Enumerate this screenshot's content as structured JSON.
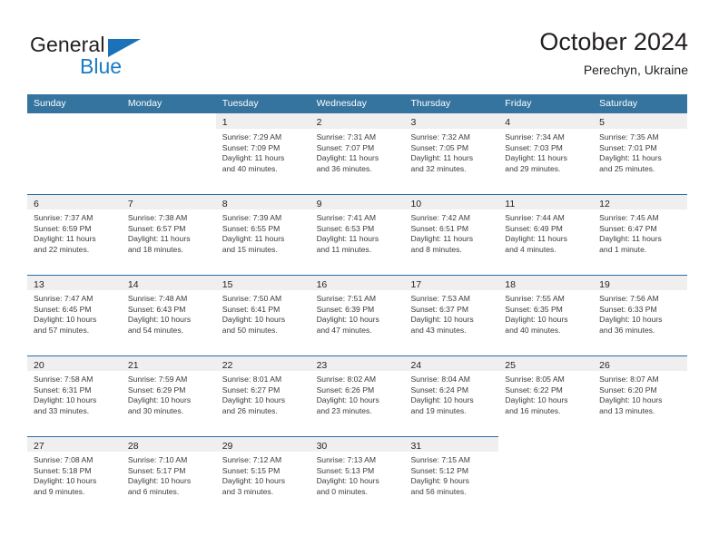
{
  "brand": {
    "name_part1": "General",
    "name_part2": "Blue",
    "accent_color": "#1b7ac4",
    "triangle_color": "#1b72b8"
  },
  "header": {
    "title": "October 2024",
    "subtitle": "Perechyn, Ukraine"
  },
  "theme": {
    "header_blue": "#35749f",
    "row_divider_blue": "#2a6ca5",
    "date_band_gray": "#efefef",
    "text_color": "#231f20"
  },
  "weekdays": [
    "Sunday",
    "Monday",
    "Tuesday",
    "Wednesday",
    "Thursday",
    "Friday",
    "Saturday"
  ],
  "weeks": [
    [
      {
        "date": "",
        "sunrise": "",
        "sunset": "",
        "daylight_l1": "",
        "daylight_l2": ""
      },
      {
        "date": "",
        "sunrise": "",
        "sunset": "",
        "daylight_l1": "",
        "daylight_l2": ""
      },
      {
        "date": "1",
        "sunrise": "Sunrise: 7:29 AM",
        "sunset": "Sunset: 7:09 PM",
        "daylight_l1": "Daylight: 11 hours",
        "daylight_l2": "and 40 minutes."
      },
      {
        "date": "2",
        "sunrise": "Sunrise: 7:31 AM",
        "sunset": "Sunset: 7:07 PM",
        "daylight_l1": "Daylight: 11 hours",
        "daylight_l2": "and 36 minutes."
      },
      {
        "date": "3",
        "sunrise": "Sunrise: 7:32 AM",
        "sunset": "Sunset: 7:05 PM",
        "daylight_l1": "Daylight: 11 hours",
        "daylight_l2": "and 32 minutes."
      },
      {
        "date": "4",
        "sunrise": "Sunrise: 7:34 AM",
        "sunset": "Sunset: 7:03 PM",
        "daylight_l1": "Daylight: 11 hours",
        "daylight_l2": "and 29 minutes."
      },
      {
        "date": "5",
        "sunrise": "Sunrise: 7:35 AM",
        "sunset": "Sunset: 7:01 PM",
        "daylight_l1": "Daylight: 11 hours",
        "daylight_l2": "and 25 minutes."
      }
    ],
    [
      {
        "date": "6",
        "sunrise": "Sunrise: 7:37 AM",
        "sunset": "Sunset: 6:59 PM",
        "daylight_l1": "Daylight: 11 hours",
        "daylight_l2": "and 22 minutes."
      },
      {
        "date": "7",
        "sunrise": "Sunrise: 7:38 AM",
        "sunset": "Sunset: 6:57 PM",
        "daylight_l1": "Daylight: 11 hours",
        "daylight_l2": "and 18 minutes."
      },
      {
        "date": "8",
        "sunrise": "Sunrise: 7:39 AM",
        "sunset": "Sunset: 6:55 PM",
        "daylight_l1": "Daylight: 11 hours",
        "daylight_l2": "and 15 minutes."
      },
      {
        "date": "9",
        "sunrise": "Sunrise: 7:41 AM",
        "sunset": "Sunset: 6:53 PM",
        "daylight_l1": "Daylight: 11 hours",
        "daylight_l2": "and 11 minutes."
      },
      {
        "date": "10",
        "sunrise": "Sunrise: 7:42 AM",
        "sunset": "Sunset: 6:51 PM",
        "daylight_l1": "Daylight: 11 hours",
        "daylight_l2": "and 8 minutes."
      },
      {
        "date": "11",
        "sunrise": "Sunrise: 7:44 AM",
        "sunset": "Sunset: 6:49 PM",
        "daylight_l1": "Daylight: 11 hours",
        "daylight_l2": "and 4 minutes."
      },
      {
        "date": "12",
        "sunrise": "Sunrise: 7:45 AM",
        "sunset": "Sunset: 6:47 PM",
        "daylight_l1": "Daylight: 11 hours",
        "daylight_l2": "and 1 minute."
      }
    ],
    [
      {
        "date": "13",
        "sunrise": "Sunrise: 7:47 AM",
        "sunset": "Sunset: 6:45 PM",
        "daylight_l1": "Daylight: 10 hours",
        "daylight_l2": "and 57 minutes."
      },
      {
        "date": "14",
        "sunrise": "Sunrise: 7:48 AM",
        "sunset": "Sunset: 6:43 PM",
        "daylight_l1": "Daylight: 10 hours",
        "daylight_l2": "and 54 minutes."
      },
      {
        "date": "15",
        "sunrise": "Sunrise: 7:50 AM",
        "sunset": "Sunset: 6:41 PM",
        "daylight_l1": "Daylight: 10 hours",
        "daylight_l2": "and 50 minutes."
      },
      {
        "date": "16",
        "sunrise": "Sunrise: 7:51 AM",
        "sunset": "Sunset: 6:39 PM",
        "daylight_l1": "Daylight: 10 hours",
        "daylight_l2": "and 47 minutes."
      },
      {
        "date": "17",
        "sunrise": "Sunrise: 7:53 AM",
        "sunset": "Sunset: 6:37 PM",
        "daylight_l1": "Daylight: 10 hours",
        "daylight_l2": "and 43 minutes."
      },
      {
        "date": "18",
        "sunrise": "Sunrise: 7:55 AM",
        "sunset": "Sunset: 6:35 PM",
        "daylight_l1": "Daylight: 10 hours",
        "daylight_l2": "and 40 minutes."
      },
      {
        "date": "19",
        "sunrise": "Sunrise: 7:56 AM",
        "sunset": "Sunset: 6:33 PM",
        "daylight_l1": "Daylight: 10 hours",
        "daylight_l2": "and 36 minutes."
      }
    ],
    [
      {
        "date": "20",
        "sunrise": "Sunrise: 7:58 AM",
        "sunset": "Sunset: 6:31 PM",
        "daylight_l1": "Daylight: 10 hours",
        "daylight_l2": "and 33 minutes."
      },
      {
        "date": "21",
        "sunrise": "Sunrise: 7:59 AM",
        "sunset": "Sunset: 6:29 PM",
        "daylight_l1": "Daylight: 10 hours",
        "daylight_l2": "and 30 minutes."
      },
      {
        "date": "22",
        "sunrise": "Sunrise: 8:01 AM",
        "sunset": "Sunset: 6:27 PM",
        "daylight_l1": "Daylight: 10 hours",
        "daylight_l2": "and 26 minutes."
      },
      {
        "date": "23",
        "sunrise": "Sunrise: 8:02 AM",
        "sunset": "Sunset: 6:26 PM",
        "daylight_l1": "Daylight: 10 hours",
        "daylight_l2": "and 23 minutes."
      },
      {
        "date": "24",
        "sunrise": "Sunrise: 8:04 AM",
        "sunset": "Sunset: 6:24 PM",
        "daylight_l1": "Daylight: 10 hours",
        "daylight_l2": "and 19 minutes."
      },
      {
        "date": "25",
        "sunrise": "Sunrise: 8:05 AM",
        "sunset": "Sunset: 6:22 PM",
        "daylight_l1": "Daylight: 10 hours",
        "daylight_l2": "and 16 minutes."
      },
      {
        "date": "26",
        "sunrise": "Sunrise: 8:07 AM",
        "sunset": "Sunset: 6:20 PM",
        "daylight_l1": "Daylight: 10 hours",
        "daylight_l2": "and 13 minutes."
      }
    ],
    [
      {
        "date": "27",
        "sunrise": "Sunrise: 7:08 AM",
        "sunset": "Sunset: 5:18 PM",
        "daylight_l1": "Daylight: 10 hours",
        "daylight_l2": "and 9 minutes."
      },
      {
        "date": "28",
        "sunrise": "Sunrise: 7:10 AM",
        "sunset": "Sunset: 5:17 PM",
        "daylight_l1": "Daylight: 10 hours",
        "daylight_l2": "and 6 minutes."
      },
      {
        "date": "29",
        "sunrise": "Sunrise: 7:12 AM",
        "sunset": "Sunset: 5:15 PM",
        "daylight_l1": "Daylight: 10 hours",
        "daylight_l2": "and 3 minutes."
      },
      {
        "date": "30",
        "sunrise": "Sunrise: 7:13 AM",
        "sunset": "Sunset: 5:13 PM",
        "daylight_l1": "Daylight: 10 hours",
        "daylight_l2": "and 0 minutes."
      },
      {
        "date": "31",
        "sunrise": "Sunrise: 7:15 AM",
        "sunset": "Sunset: 5:12 PM",
        "daylight_l1": "Daylight: 9 hours",
        "daylight_l2": "and 56 minutes."
      },
      {
        "date": "",
        "sunrise": "",
        "sunset": "",
        "daylight_l1": "",
        "daylight_l2": ""
      },
      {
        "date": "",
        "sunrise": "",
        "sunset": "",
        "daylight_l1": "",
        "daylight_l2": ""
      }
    ]
  ]
}
